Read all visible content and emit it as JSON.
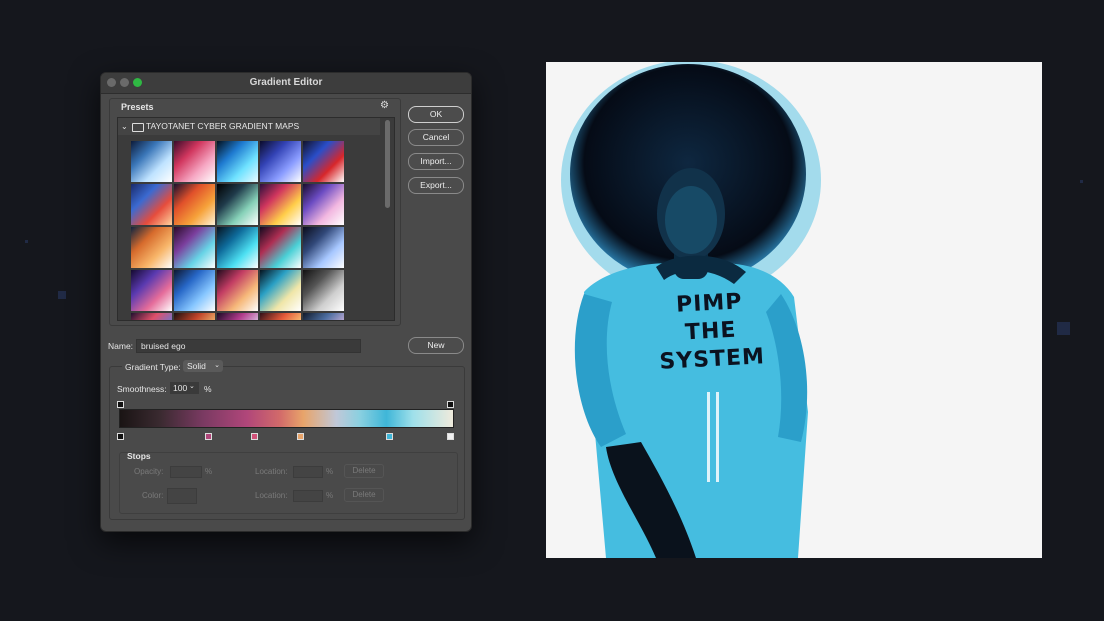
{
  "window": {
    "title": "Gradient Editor",
    "presets_label": "Presets",
    "folder_name": "TAYOTANET CYBER GRADIENT MAPS",
    "buttons": {
      "ok": "OK",
      "cancel": "Cancel",
      "import": "Import...",
      "export": "Export...",
      "new": "New"
    },
    "name_label": "Name:",
    "name_value": "bruised ego",
    "gradient_type_label": "Gradient Type:",
    "gradient_type_value": "Solid",
    "smoothness_label": "Smoothness:",
    "smoothness_value": "100",
    "smoothness_unit": "%",
    "stops": {
      "label": "Stops",
      "opacity_label": "Opacity:",
      "color_label": "Color:",
      "location_label": "Location:",
      "percent": "%",
      "delete_label": "Delete"
    }
  },
  "canvas": {
    "shirt_lines": [
      "PIMP",
      "THE",
      "SYSTEM"
    ]
  },
  "colors": {
    "window_bg": "#4a4a4a",
    "accent_green": "#2fb843",
    "image_cyan": "#3fb6d8",
    "image_dark": "#0a1322"
  }
}
